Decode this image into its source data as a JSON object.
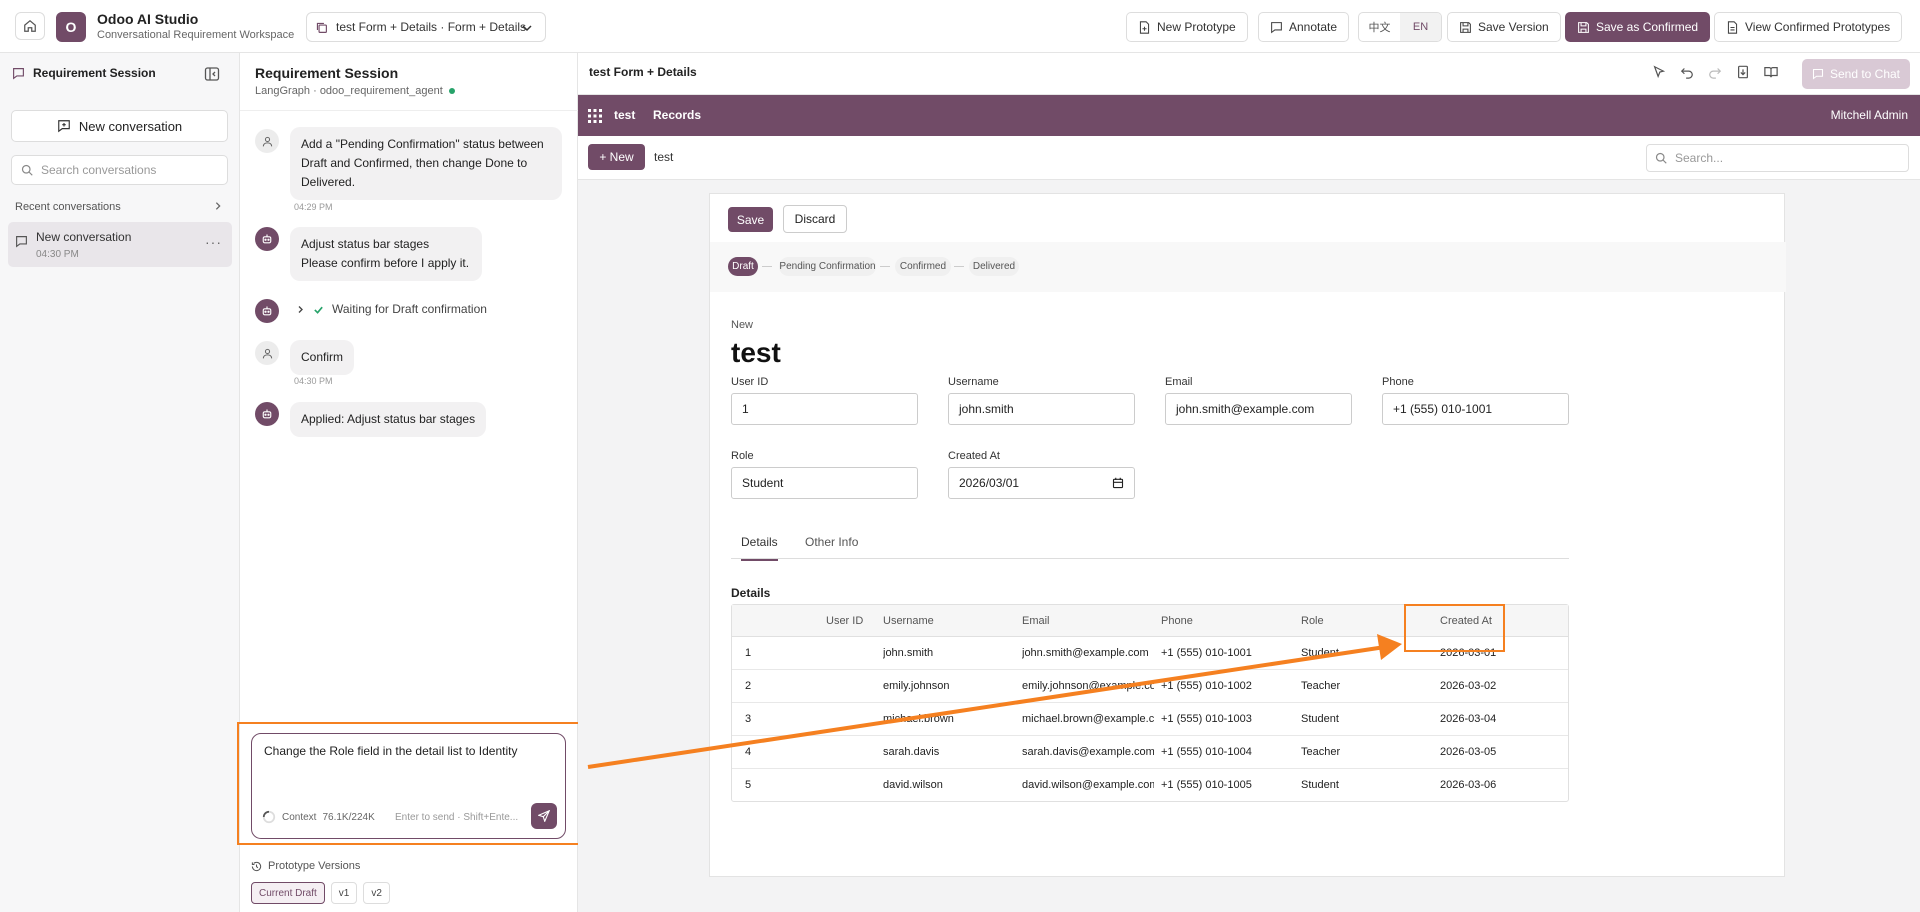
{
  "topbar": {
    "logo_letter": "O",
    "app_title": "Odoo AI Studio",
    "app_subtitle": "Conversational Requirement Workspace",
    "prototype_selected": "test Form + Details · Form + Details",
    "new_prototype": "New Prototype",
    "annotate": "Annotate",
    "lang_zh": "中文",
    "lang_en": "EN",
    "save_version": "Save Version",
    "save_confirmed": "Save as Confirmed",
    "view_confirmed": "View Confirmed Prototypes"
  },
  "sidebar": {
    "title": "Requirement Session",
    "new_conversation": "New conversation",
    "search_placeholder": "Search conversations",
    "recent_label": "Recent conversations",
    "conversations": [
      {
        "title": "New conversation",
        "time": "04:30 PM"
      }
    ]
  },
  "chat": {
    "title": "Requirement Session",
    "subtitle": "LangGraph · odoo_requirement_agent",
    "messages": [
      {
        "role": "user",
        "lines": [
          "Add a \"Pending Confirmation\" status between",
          "Draft and Confirmed, then change Done to",
          "Delivered."
        ],
        "time": "04:29 PM"
      },
      {
        "role": "bot",
        "lines": [
          "Adjust status bar stages",
          "Please confirm before I apply it."
        ]
      },
      {
        "role": "bot",
        "tool": "Waiting for Draft confirmation"
      },
      {
        "role": "user",
        "lines": [
          "Confirm"
        ],
        "time": "04:30 PM"
      },
      {
        "role": "bot",
        "lines": [
          "Applied: Adjust status bar stages"
        ]
      }
    ],
    "composer": {
      "text": "Change the Role field in the detail list to Identity",
      "context_label": "Context",
      "context_value": "76.1K/224K",
      "hint": "Enter to send · Shift+Ente..."
    },
    "versions_label": "Prototype Versions",
    "versions": [
      "Current Draft",
      "v1",
      "v2"
    ]
  },
  "preview": {
    "title": "test Form + Details",
    "send_to_chat": "Send to Chat",
    "nav": {
      "app": "test",
      "menu": "Records",
      "user": "Mitchell Admin"
    },
    "new_button": "+ New",
    "breadcrumb": "test",
    "search_placeholder": "Search...",
    "save": "Save",
    "discard": "Discard",
    "stages": [
      "Draft",
      "Pending Confirmation",
      "Confirmed",
      "Delivered"
    ],
    "current_stage": "Draft",
    "new_label": "New",
    "record_title": "test",
    "fields": {
      "user_id": {
        "label": "User ID",
        "value": "1"
      },
      "username": {
        "label": "Username",
        "value": "john.smith"
      },
      "email": {
        "label": "Email",
        "value": "john.smith@example.com"
      },
      "phone": {
        "label": "Phone",
        "value": "+1 (555) 010-1001"
      },
      "role": {
        "label": "Role",
        "value": "Student"
      },
      "created_at": {
        "label": "Created At",
        "value": "2026/03/01"
      }
    },
    "tabs": [
      "Details",
      "Other Info"
    ],
    "details_label": "Details",
    "table": {
      "headers": [
        "User ID",
        "Username",
        "Email",
        "Phone",
        "Role",
        "Created At"
      ],
      "rows": [
        [
          "1",
          "john.smith",
          "john.smith@example.com",
          "+1 (555) 010-1001",
          "Student",
          "2026-03-01"
        ],
        [
          "2",
          "emily.johnson",
          "emily.johnson@example.com",
          "+1 (555) 010-1002",
          "Teacher",
          "2026-03-02"
        ],
        [
          "3",
          "michael.brown",
          "michael.brown@example.com",
          "+1 (555) 010-1003",
          "Student",
          "2026-03-04"
        ],
        [
          "4",
          "sarah.davis",
          "sarah.davis@example.com",
          "+1 (555) 010-1004",
          "Teacher",
          "2026-03-05"
        ],
        [
          "5",
          "david.wilson",
          "david.wilson@example.com",
          "+1 (555) 010-1005",
          "Student",
          "2026-03-06"
        ]
      ]
    }
  },
  "colors": {
    "brand": "#714b67",
    "annotation": "#f58020",
    "online": "#27a36a"
  }
}
